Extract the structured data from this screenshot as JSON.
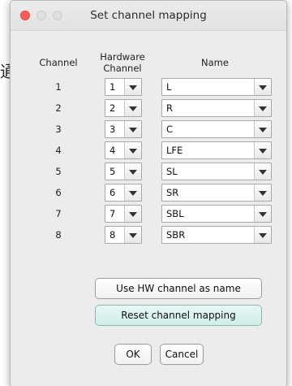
{
  "background": {
    "glyph": "通"
  },
  "window": {
    "title": "Set channel mapping"
  },
  "headers": {
    "channel": "Channel",
    "hardware_line1": "Hardware",
    "hardware_line2": "Channel",
    "name": "Name"
  },
  "rows": [
    {
      "channel": "1",
      "hardware": "1",
      "name": "L"
    },
    {
      "channel": "2",
      "hardware": "2",
      "name": "R"
    },
    {
      "channel": "3",
      "hardware": "3",
      "name": "C"
    },
    {
      "channel": "4",
      "hardware": "4",
      "name": "LFE"
    },
    {
      "channel": "5",
      "hardware": "5",
      "name": "SL"
    },
    {
      "channel": "6",
      "hardware": "6",
      "name": "SR"
    },
    {
      "channel": "7",
      "hardware": "7",
      "name": "SBL"
    },
    {
      "channel": "8",
      "hardware": "8",
      "name": "SBR"
    }
  ],
  "buttons": {
    "use_hw": "Use HW channel as name",
    "reset": "Reset channel mapping",
    "ok": "OK",
    "cancel": "Cancel"
  },
  "colors": {
    "close": "#fc5f57",
    "accent_button": "#cfeeea"
  },
  "icons": {
    "dropdown": "chevron-down-icon"
  }
}
